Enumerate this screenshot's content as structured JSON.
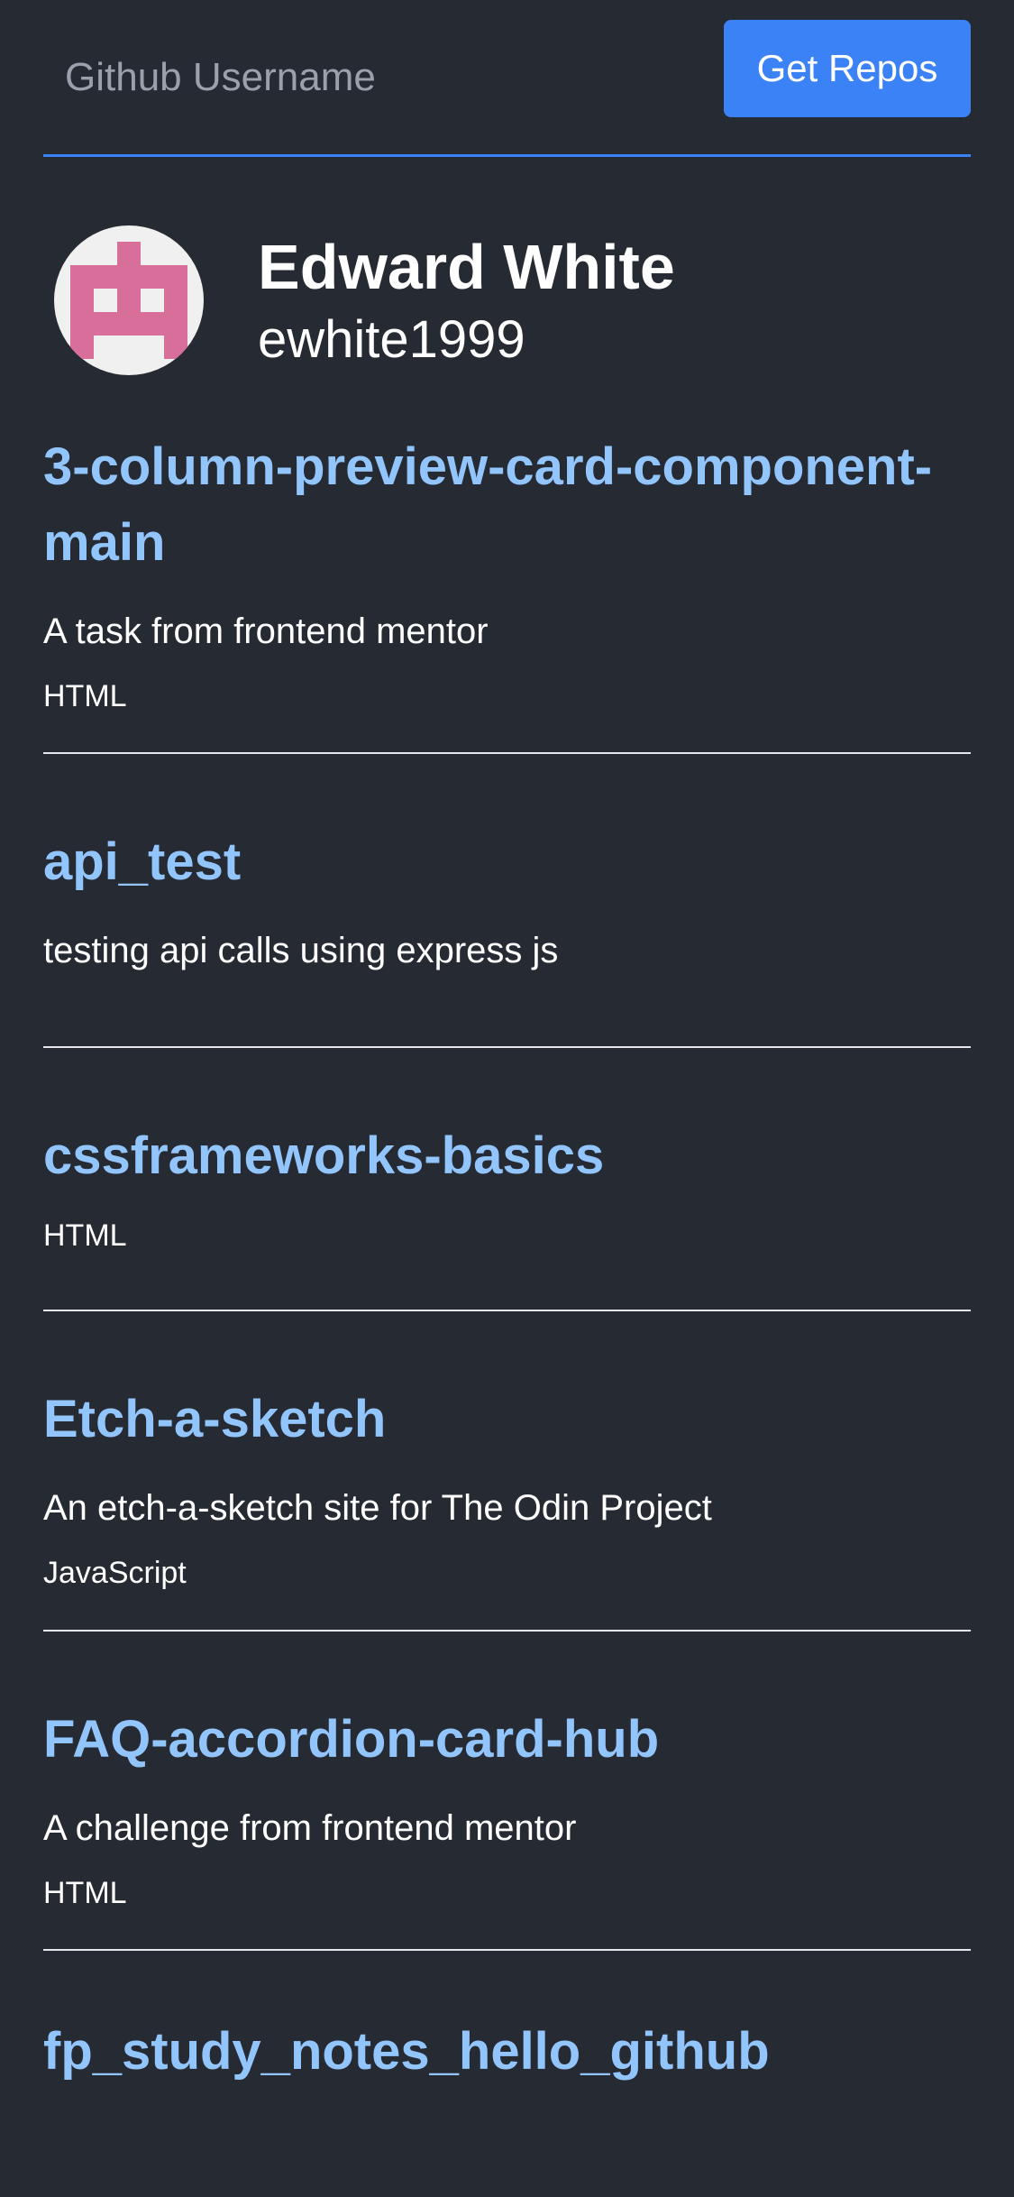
{
  "search": {
    "placeholder": "Github Username",
    "button_label": "Get Repos"
  },
  "profile": {
    "name": "Edward White",
    "login": "ewhite1999",
    "avatar_icon": "pixel-identicon",
    "avatar_color": "#d86e9a"
  },
  "repos": [
    {
      "name": "3-column-preview-card-component-main",
      "description": "A task from frontend mentor",
      "language": "HTML"
    },
    {
      "name": "api_test",
      "description": "testing api calls using express js",
      "language": ""
    },
    {
      "name": "cssframeworks-basics",
      "description": "",
      "language": "HTML"
    },
    {
      "name": "Etch-a-sketch",
      "description": "An etch-a-sketch site for The Odin Project",
      "language": "JavaScript"
    },
    {
      "name": "FAQ-accordion-card-hub",
      "description": "A challenge from frontend mentor",
      "language": "HTML"
    },
    {
      "name": "fp_study_notes_hello_github",
      "description": "",
      "language": ""
    }
  ],
  "colors": {
    "background": "#262a33",
    "accent": "#3b82f6",
    "link": "#93c5fd"
  }
}
